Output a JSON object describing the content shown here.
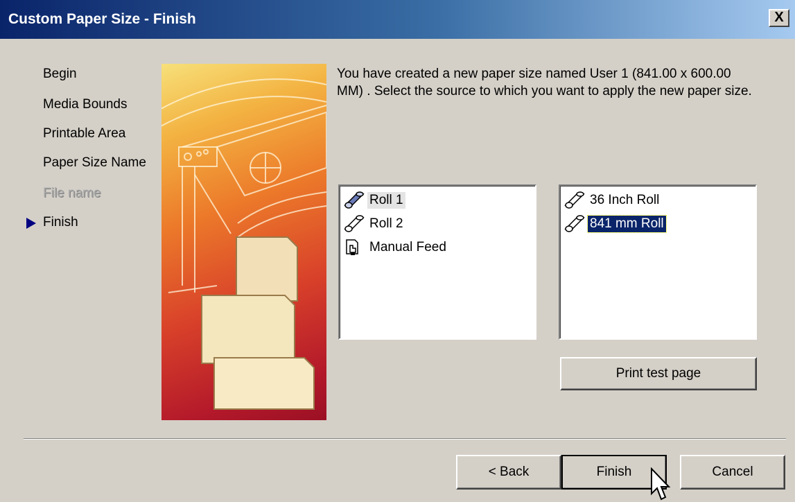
{
  "window": {
    "title": "Custom Paper Size - Finish",
    "close_label": "X",
    "titlebar_color": "#0a246a"
  },
  "steps": [
    {
      "label": "Begin",
      "state": "done"
    },
    {
      "label": "Media Bounds",
      "state": "done"
    },
    {
      "label": "Printable Area",
      "state": "done"
    },
    {
      "label": "Paper Size Name",
      "state": "done"
    },
    {
      "label": "File name",
      "state": "disabled"
    },
    {
      "label": "Finish",
      "state": "current",
      "icon": "arrow-right-icon"
    }
  ],
  "description": "You have created a new paper size named User 1 (841.00 x 600.00 MM) . Select the source to which you want to apply the new paper size.",
  "sources": {
    "items": [
      {
        "label": "Roll 1",
        "icon": "paper-roll-icon",
        "state": "hover"
      },
      {
        "label": "Roll 2",
        "icon": "paper-roll-icon",
        "state": "normal"
      },
      {
        "label": "Manual Feed",
        "icon": "manual-feed-icon",
        "state": "normal"
      }
    ]
  },
  "rolls": {
    "items": [
      {
        "label": "36 Inch Roll",
        "icon": "paper-roll-icon",
        "state": "normal"
      },
      {
        "label": "841 mm Roll",
        "icon": "paper-roll-icon",
        "state": "selected"
      }
    ]
  },
  "buttons": {
    "print_test_page": "Print test page",
    "back": "< Back",
    "finish": "Finish",
    "cancel": "Cancel"
  }
}
